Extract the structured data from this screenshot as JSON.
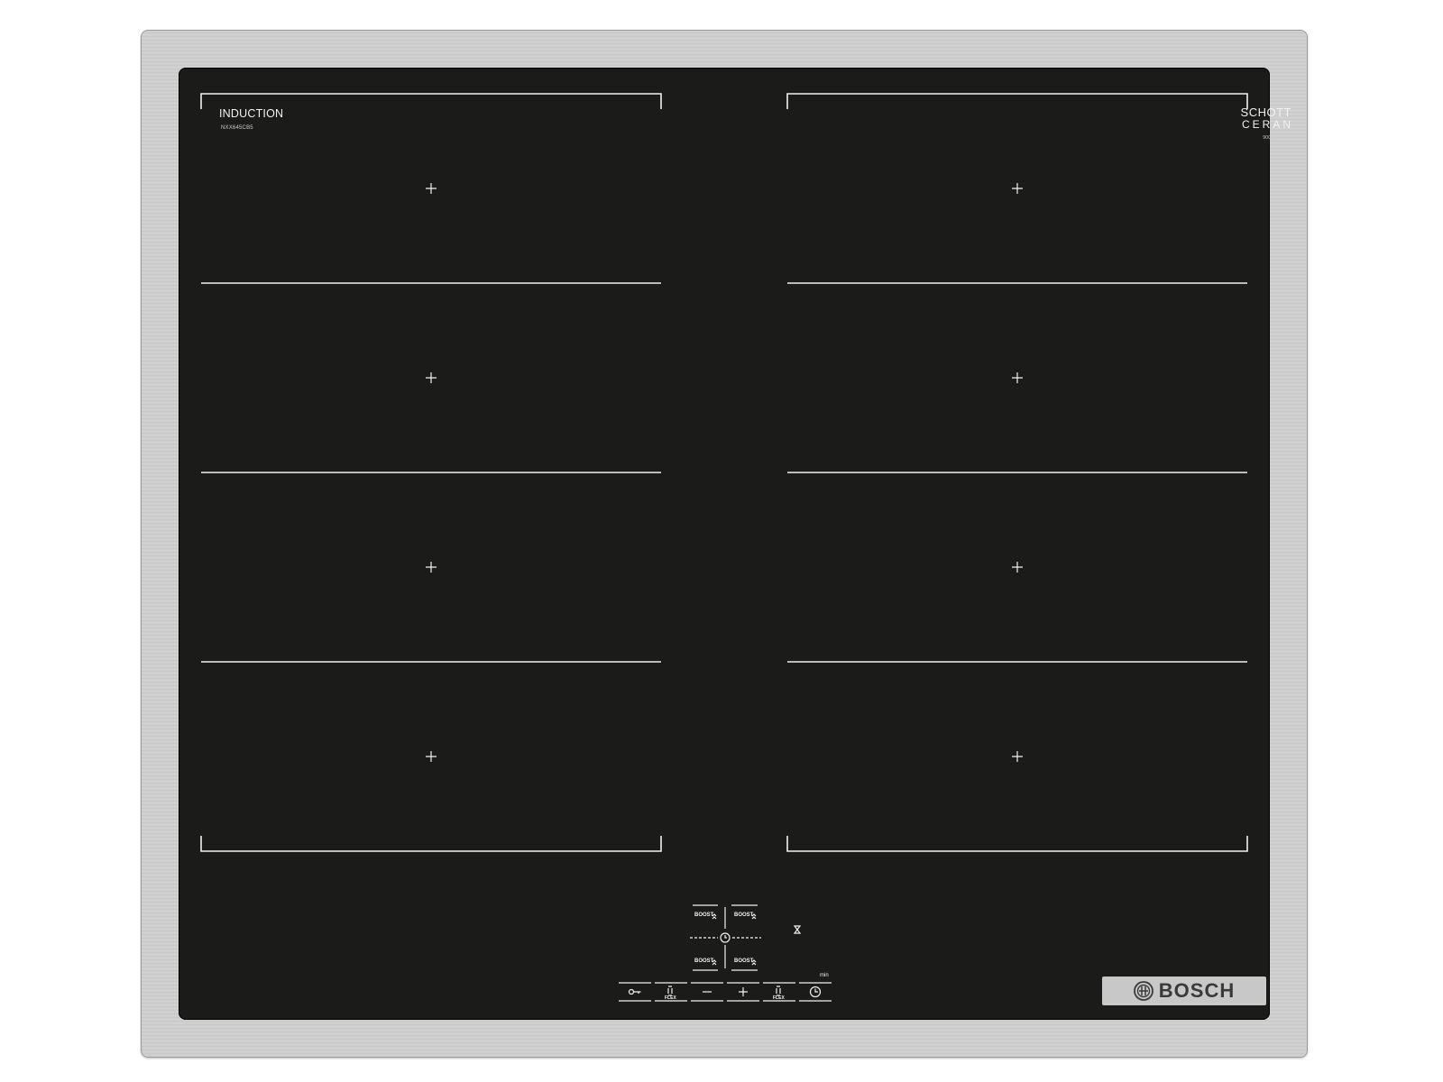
{
  "product": {
    "induction_label": "INDUCTION",
    "model_number": "NXX645CB5",
    "schott_line1": "SCHOTT",
    "schott_line2": "CERAN",
    "serial": "9001400715",
    "brand": "BOSCH"
  },
  "controls": {
    "boost_label": "BOOST",
    "flex_label": "FLEX",
    "min_label": "min",
    "buttons": [
      "key-lock",
      "flex-left",
      "minus",
      "plus",
      "flex-right",
      "timer"
    ]
  },
  "icons": {
    "zone_center": "plus-cross-icon",
    "boost": "double-chevron-up-icon",
    "hourglass": "hourglass-icon",
    "key": "key-icon",
    "clock": "clock-icon"
  },
  "colors": {
    "glass": "#1b1b1a",
    "markings": "#f2f2f2",
    "frame": "#c8c8c8",
    "logo_plate": "#c8c8c8",
    "logo_text": "#3a3a3a"
  }
}
